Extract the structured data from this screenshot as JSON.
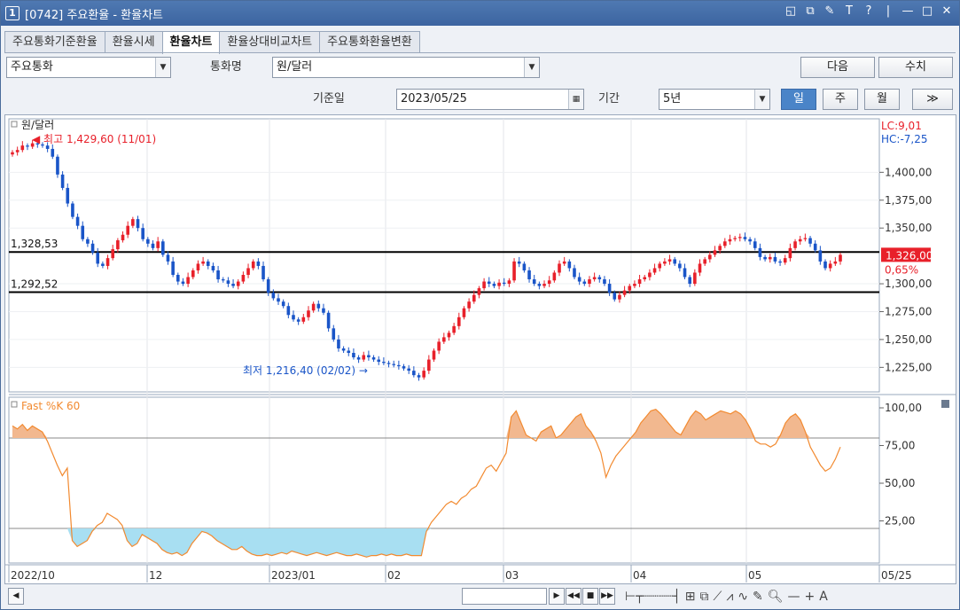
{
  "window": {
    "num": "1",
    "title": "[0742] 주요환율 - 환율차트"
  },
  "titlebar_icons": [
    "◱",
    "⧉",
    "✎",
    "T",
    "?",
    "|",
    "—",
    "□",
    "✕"
  ],
  "tabs": [
    "주요통화기준환율",
    "환율시세",
    "환율차트",
    "환율상대비교차트",
    "주요통화환율변환"
  ],
  "active_tab": 2,
  "controls": {
    "currency_group": "주요통화",
    "currency_label": "통화명",
    "currency": "원/달러",
    "next_btn": "다음",
    "value_btn": "수치",
    "base_date_label": "기준일",
    "base_date": "2023/05/25",
    "period_label": "기간",
    "period": "5년",
    "periods": [
      "일",
      "주",
      "월"
    ],
    "active_period": 0,
    "more_btn": "≫"
  },
  "colors": {
    "up": "#e8202a",
    "down": "#1a55c8",
    "stoch": "#f28a30",
    "stoch_upper_fill": "#f2b88f",
    "stoch_lower_fill": "#a8dff2"
  },
  "chart_data": [
    {
      "type": "candlestick",
      "series_label": "원/달러",
      "x_labels": [
        "2022/10",
        "12",
        "2023/01",
        "02",
        "03",
        "04",
        "05",
        "05/25"
      ],
      "y_ticks": [
        1400,
        1375,
        1350,
        1325,
        1300,
        1275,
        1250,
        1225
      ],
      "y_tick_labels": [
        "1,400,00",
        "1,375,00",
        "1,350,00",
        "1,300,00",
        "1,275,00",
        "1,250,00",
        "1,225,00"
      ],
      "ylim": [
        1203,
        1448
      ],
      "hlines": [
        {
          "value": 1328.53,
          "label": "1,328,53"
        },
        {
          "value": 1292.52,
          "label": "1,292,52"
        }
      ],
      "high_annotation": "최고 1,429,60 (11/01)",
      "low_annotation": "최저 1,216,40 (02/02)",
      "lc_label": "LC:9,01",
      "hc_label": "HC:-7,25",
      "last_price": 1326.0,
      "last_price_label": "1,326,00",
      "last_change": "0,65%",
      "closes": [
        1418,
        1420,
        1424,
        1423,
        1426,
        1425,
        1424,
        1421,
        1414,
        1398,
        1386,
        1372,
        1360,
        1352,
        1340,
        1336,
        1328,
        1318,
        1316,
        1323,
        1331,
        1339,
        1344,
        1352,
        1358,
        1350,
        1340,
        1336,
        1332,
        1338,
        1326,
        1320,
        1308,
        1302,
        1300,
        1306,
        1312,
        1318,
        1320,
        1316,
        1312,
        1304,
        1303,
        1300,
        1298,
        1302,
        1308,
        1314,
        1320,
        1316,
        1304,
        1292,
        1287,
        1284,
        1280,
        1272,
        1268,
        1266,
        1270,
        1276,
        1282,
        1278,
        1274,
        1260,
        1250,
        1242,
        1240,
        1238,
        1234,
        1232,
        1236,
        1234,
        1232,
        1230,
        1229,
        1228,
        1227,
        1226,
        1224,
        1222,
        1218,
        1216,
        1222,
        1232,
        1240,
        1248,
        1252,
        1256,
        1262,
        1270,
        1278,
        1284,
        1290,
        1296,
        1302,
        1300,
        1298,
        1301,
        1300,
        1303,
        1320,
        1318,
        1312,
        1304,
        1300,
        1298,
        1300,
        1303,
        1310,
        1318,
        1320,
        1314,
        1306,
        1302,
        1300,
        1304,
        1306,
        1304,
        1300,
        1292,
        1286,
        1290,
        1294,
        1298,
        1300,
        1304,
        1306,
        1310,
        1314,
        1318,
        1320,
        1322,
        1318,
        1314,
        1306,
        1300,
        1310,
        1318,
        1322,
        1326,
        1330,
        1334,
        1338,
        1340,
        1341,
        1342,
        1340,
        1338,
        1332,
        1324,
        1322,
        1324,
        1320,
        1319,
        1323,
        1332,
        1338,
        1340,
        1341,
        1336,
        1330,
        1320,
        1314,
        1318,
        1320,
        1326
      ],
      "subchart": {
        "type": "area",
        "label": "Fast %K 60",
        "y_ticks": [
          100,
          75,
          50,
          25
        ],
        "y_tick_labels": [
          "100,00",
          "75,00",
          "50,00",
          "25,00"
        ],
        "hlines": [
          80,
          20
        ],
        "values": [
          88,
          86,
          89,
          85,
          88,
          86,
          84,
          78,
          70,
          62,
          55,
          60,
          12,
          8,
          10,
          12,
          18,
          22,
          24,
          30,
          28,
          26,
          22,
          12,
          8,
          10,
          16,
          14,
          12,
          10,
          6,
          4,
          3,
          4,
          2,
          4,
          10,
          14,
          18,
          17,
          15,
          12,
          10,
          8,
          6,
          6,
          8,
          5,
          3,
          2,
          2,
          3,
          2,
          3,
          4,
          3,
          5,
          4,
          3,
          2,
          3,
          4,
          3,
          2,
          3,
          4,
          3,
          2,
          2,
          3,
          2,
          1,
          2,
          2,
          3,
          2,
          3,
          2,
          2,
          3,
          2,
          2,
          2,
          18,
          24,
          28,
          32,
          36,
          38,
          36,
          40,
          42,
          46,
          48,
          54,
          60,
          62,
          58,
          64,
          70,
          94,
          98,
          90,
          82,
          80,
          78,
          84,
          86,
          88,
          80,
          82,
          86,
          90,
          94,
          96,
          88,
          84,
          78,
          70,
          54,
          62,
          68,
          72,
          76,
          80,
          84,
          90,
          94,
          98,
          99,
          96,
          92,
          88,
          84,
          82,
          88,
          94,
          98,
          96,
          92,
          94,
          96,
          98,
          97,
          96,
          98,
          96,
          92,
          86,
          78,
          76,
          76,
          74,
          76,
          82,
          90,
          94,
          96,
          92,
          84,
          74,
          68,
          62,
          58,
          60,
          66,
          74
        ]
      }
    }
  ]
}
